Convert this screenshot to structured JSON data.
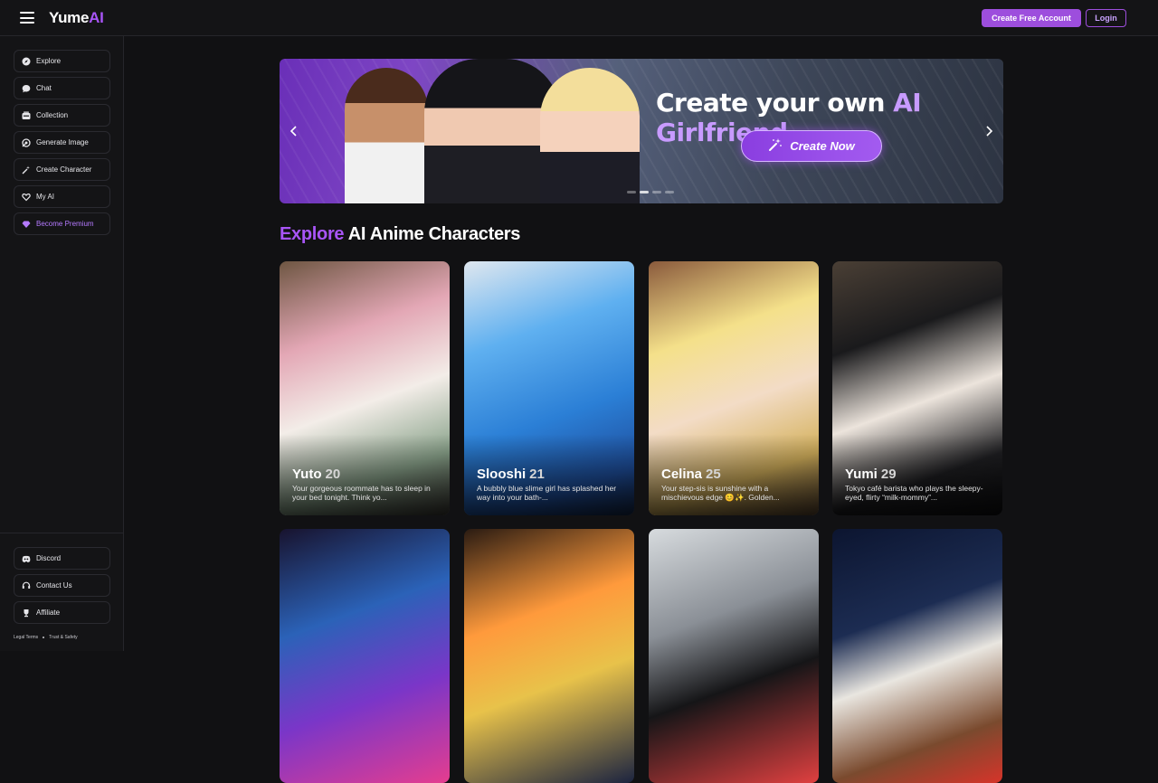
{
  "header": {
    "logo_main": "Yume",
    "logo_accent": "AI",
    "create_account_label": "Create Free Account",
    "login_label": "Login"
  },
  "sidebar": {
    "items": [
      {
        "label": "Explore",
        "icon": "compass-icon"
      },
      {
        "label": "Chat",
        "icon": "chat-bubble-icon"
      },
      {
        "label": "Collection",
        "icon": "collection-icon"
      },
      {
        "label": "Generate Image",
        "icon": "image-gen-icon"
      },
      {
        "label": "Create Character",
        "icon": "magic-wand-icon"
      },
      {
        "label": "My AI",
        "icon": "heart-hands-icon"
      },
      {
        "label": "Become Premium",
        "icon": "diamond-icon"
      }
    ],
    "bottom_items": [
      {
        "label": "Discord",
        "icon": "discord-icon"
      },
      {
        "label": "Contact Us",
        "icon": "headset-icon"
      },
      {
        "label": "Affiliate",
        "icon": "trophy-icon"
      }
    ],
    "legal": {
      "terms": "Legal Terms",
      "safety": "Trust & Safety"
    }
  },
  "banner": {
    "title_prefix": "Create your own",
    "title_highlight": "AI Girlfriend",
    "cta_label": "Create Now"
  },
  "section": {
    "title_highlight": "Explore",
    "title_rest": "AI Anime Characters"
  },
  "characters": [
    {
      "name": "Yuto",
      "age": "20",
      "desc": "Your gorgeous roommate has to sleep in your bed tonight. Think yo..."
    },
    {
      "name": "Slooshi",
      "age": "21",
      "desc": "A bubbly blue slime girl has splashed her way into your bath-..."
    },
    {
      "name": "Celina",
      "age": "25",
      "desc": "Your step-sis is sunshine with a mischievous edge 😊✨. Golden..."
    },
    {
      "name": "Yumi",
      "age": "29",
      "desc": "Tokyo café barista who plays the sleepy-eyed, flirty “milk-mommy”..."
    }
  ],
  "colors": {
    "accent": "#a855f7",
    "button": "#9d4edd",
    "background": "#111113"
  }
}
